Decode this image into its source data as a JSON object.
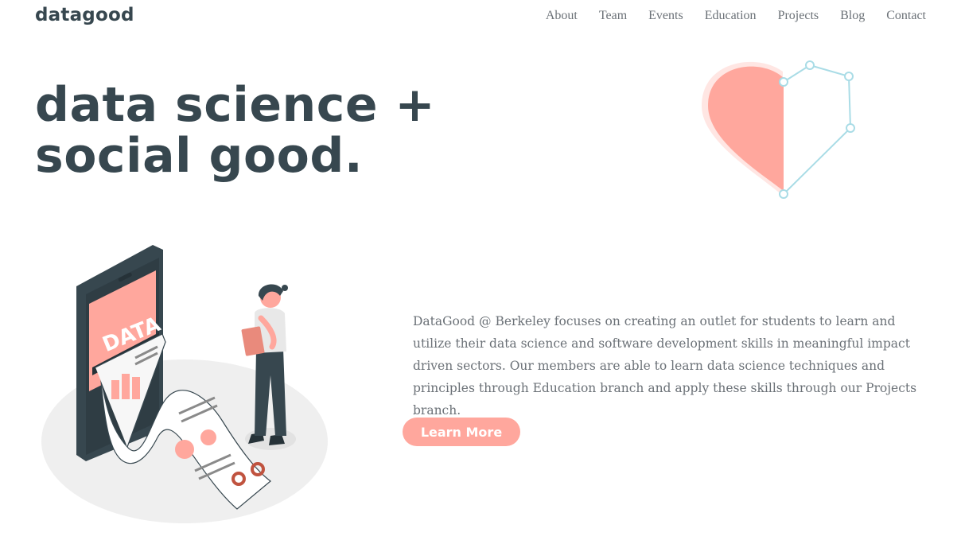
{
  "brand": {
    "logo": "datagood"
  },
  "nav": {
    "items": [
      "About",
      "Team",
      "Events",
      "Education",
      "Projects",
      "Blog",
      "Contact"
    ]
  },
  "hero": {
    "title": "data science + social good."
  },
  "illustration": {
    "screen_text": "DATA"
  },
  "intro": {
    "description": "DataGood @ Berkeley focuses on creating an outlet for students to learn and utilize their data science and software development skills in meaningful impact driven sectors. Our members are able to learn data science techniques and principles through Education branch and apply these skills through our Projects branch.",
    "cta_label": "Learn More"
  },
  "colors": {
    "accent": "#ffa79d",
    "text_dark": "#37474f",
    "text_muted": "#6b7177",
    "heart_outline": "#a9dce6"
  }
}
